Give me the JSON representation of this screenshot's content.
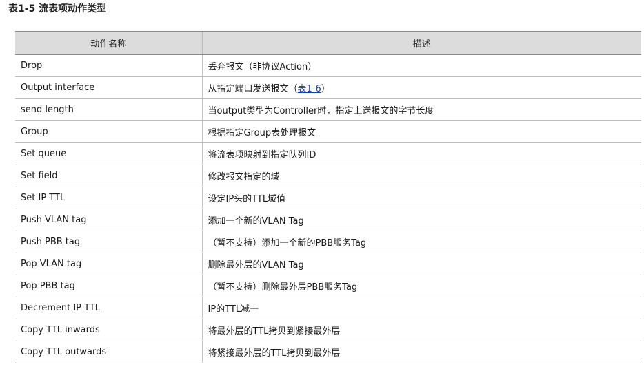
{
  "caption": "表1-5 流表项动作类型",
  "table": {
    "headers": [
      "动作名称",
      "描述"
    ],
    "rows": [
      {
        "name": "Drop",
        "desc": "丢弃报文（非协议Action）"
      },
      {
        "name": "Output interface",
        "desc_pre": "从指定端口发送报文（",
        "desc_link": "表1-6",
        "desc_post": "）"
      },
      {
        "name": "send length",
        "desc": "当output类型为Controller时，指定上送报文的字节长度"
      },
      {
        "name": "Group",
        "desc": "根据指定Group表处理报文"
      },
      {
        "name": "Set queue",
        "desc": "将流表项映射到指定队列ID"
      },
      {
        "name": "Set field",
        "desc": "修改报文指定的域"
      },
      {
        "name": "Set IP TTL",
        "desc": "设定IP头的TTL域值"
      },
      {
        "name": "Push VLAN tag",
        "desc": "添加一个新的VLAN Tag"
      },
      {
        "name": "Push PBB tag",
        "desc": "（暂不支持）添加一个新的PBB服务Tag"
      },
      {
        "name": "Pop VLAN tag",
        "desc": "删除最外层的VLAN Tag"
      },
      {
        "name": "Pop PBB tag",
        "desc": "（暂不支持）删除最外层PBB服务Tag"
      },
      {
        "name": "Decrement IP TTL",
        "desc": "IP的TTL减一"
      },
      {
        "name": "Copy TTL inwards",
        "desc": "将最外层的TTL拷贝到紧接最外层"
      },
      {
        "name": "Copy TTL outwards",
        "desc": "将紧接最外层的TTL拷贝到最外层"
      }
    ]
  }
}
